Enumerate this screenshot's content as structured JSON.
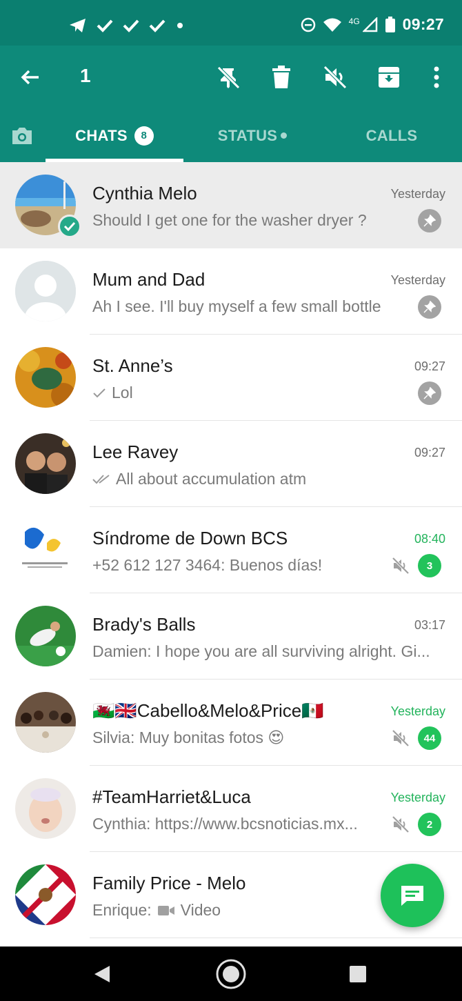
{
  "status_bar": {
    "time": "09:27",
    "network": "4G",
    "icons": [
      "telegram-icon",
      "check-icon",
      "check-icon",
      "check-icon",
      "dot-icon",
      "dnd-icon",
      "wifi-icon",
      "signal-icon",
      "battery-icon"
    ]
  },
  "action_bar": {
    "selected_count": "1",
    "icons": [
      "back-arrow-icon",
      "unpin-icon",
      "delete-icon",
      "mute-icon",
      "archive-icon",
      "more-vert-icon"
    ]
  },
  "tabs": {
    "chats": "CHATS",
    "chats_badge": "8",
    "status": "STATUS",
    "calls": "CALLS"
  },
  "chats": [
    {
      "name": "Cynthia Melo",
      "time": "Yesterday",
      "preview": "Should I get one for the washer dryer ?",
      "pinned": true,
      "selected": true
    },
    {
      "name": "Mum and Dad",
      "time": "Yesterday",
      "preview": "Ah I see. I'll buy myself a few small bottle...",
      "pinned": true
    },
    {
      "name": "St. Anne’s",
      "time": "09:27",
      "preview": "Lol",
      "pinned": true,
      "tick": "single"
    },
    {
      "name": "Lee Ravey",
      "time": "09:27",
      "preview": "All about accumulation atm",
      "tick": "double"
    },
    {
      "name": "Síndrome de Down BCS",
      "time": "08:40",
      "preview": "+52 612 127 3464: Buenos días!",
      "muted": true,
      "unread": "3"
    },
    {
      "name": "Brady's Balls",
      "time": "03:17",
      "preview": "Damien: I hope you are all surviving alright. Gi..."
    },
    {
      "name": "🏴󠁧󠁢󠁷󠁬󠁳󠁿🇬🇧Cabello&Melo&Price🇲🇽",
      "time": "Yesterday",
      "preview": "Silvia: Muy bonitas fotos 😍",
      "muted": true,
      "unread": "44"
    },
    {
      "name": "#TeamHarriet&Luca",
      "time": "Yesterday",
      "preview": "Cynthia: https://www.bcsnoticias.mx...",
      "muted": true,
      "unread": "2"
    },
    {
      "name": "Family Price - Melo",
      "time": "",
      "preview_prefix": "Enrique:",
      "preview": "Video"
    }
  ],
  "colors": {
    "status_bar": "#0b7f70",
    "toolbar": "#0e8a7a",
    "accent_green": "#22c35b",
    "selected_row": "#ececec"
  },
  "fab": {
    "icon": "new-chat-icon"
  },
  "nav": {
    "icons": [
      "nav-back-icon",
      "nav-home-icon",
      "nav-recents-icon"
    ]
  }
}
